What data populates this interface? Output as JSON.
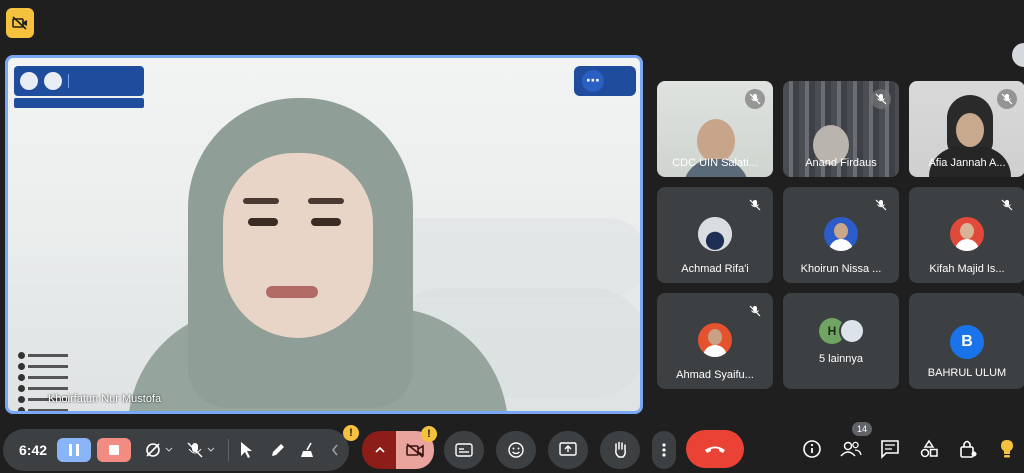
{
  "main_speaker": {
    "name": "Khoirfatun Nur Mustofa"
  },
  "participants": [
    {
      "name": "CDC UIN Salati...",
      "muted": true,
      "type": "video"
    },
    {
      "name": "Anand Firdaus",
      "muted": true,
      "type": "video"
    },
    {
      "name": "Afia Jannah A...",
      "muted": true,
      "type": "video"
    },
    {
      "name": "Achmad Rifa'i",
      "muted": true,
      "type": "avatar"
    },
    {
      "name": "Khoirun Nissa ...",
      "muted": true,
      "type": "avatar"
    },
    {
      "name": "Kifah Majid Is...",
      "muted": true,
      "type": "avatar"
    },
    {
      "name": "Ahmad Syaifu...",
      "muted": true,
      "type": "avatar"
    },
    {
      "name": "5 lainnya",
      "type": "others",
      "initial": "H"
    },
    {
      "name": "BAHRUL ULUM",
      "type": "initial",
      "initial": "B"
    }
  ],
  "toolbar": {
    "time": "6:42",
    "participant_count": "14",
    "warn_glyph": "!"
  },
  "colors": {
    "accent": "#7aa7f5",
    "end_call": "#ea4335",
    "warn": "#f6c23e",
    "tile_bg": "#3c4043"
  }
}
